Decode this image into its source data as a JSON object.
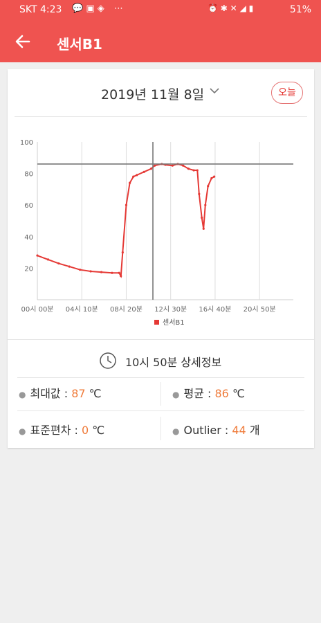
{
  "status_bar": {
    "carrier_time": "SKT 4:23",
    "notification_icons": [
      "chat-bubble-icon",
      "image-icon",
      "message-icon",
      "more-icon"
    ],
    "system_icons": [
      "alarm-icon",
      "bluetooth-icon",
      "mute-icon",
      "wifi-icon",
      "signal-icon"
    ],
    "battery": "51%"
  },
  "toolbar": {
    "back_icon": "arrow-left-icon",
    "title": "센서B1",
    "color": "#ef5350"
  },
  "date_selector": {
    "date": "2019년 11월 8일",
    "dropdown_icon": "chevron-down-icon",
    "today_label": "오늘"
  },
  "chart_data": {
    "type": "line",
    "x_tick_labels": [
      "00시 00분",
      "04시 10분",
      "08시 20분",
      "12시 30분",
      "16시 40분",
      "20시 50분"
    ],
    "y_ticks": [
      20,
      40,
      60,
      80,
      100
    ],
    "ylim": [
      0,
      100
    ],
    "xlim_minutes": [
      0,
      1440
    ],
    "grid": "vertical gridlines",
    "legend": "bottom-center",
    "series": [
      {
        "name": "센서B1",
        "color": "#e53935",
        "points": [
          [
            0,
            28
          ],
          [
            60,
            25.5
          ],
          [
            120,
            23
          ],
          [
            180,
            21
          ],
          [
            240,
            19
          ],
          [
            300,
            18
          ],
          [
            360,
            17.5
          ],
          [
            420,
            17
          ],
          [
            460,
            17
          ],
          [
            470,
            15
          ],
          [
            480,
            30
          ],
          [
            500,
            60
          ],
          [
            520,
            74
          ],
          [
            540,
            78
          ],
          [
            560,
            79
          ],
          [
            600,
            81
          ],
          [
            640,
            83
          ],
          [
            660,
            85
          ],
          [
            700,
            86
          ],
          [
            720,
            85.5
          ],
          [
            760,
            85
          ],
          [
            790,
            86
          ],
          [
            820,
            85
          ],
          [
            850,
            83
          ],
          [
            880,
            82
          ],
          [
            900,
            82
          ],
          [
            910,
            67
          ],
          [
            925,
            52
          ],
          [
            935,
            45
          ],
          [
            945,
            60
          ],
          [
            960,
            72
          ],
          [
            980,
            77
          ],
          [
            995,
            78
          ]
        ]
      }
    ],
    "crosshair": {
      "x_minutes": 650,
      "y": 86
    }
  },
  "detail_info": {
    "clock_icon": "clock-icon",
    "title": "10시 50분 상세정보",
    "max_label": "최대값",
    "max_value": "87",
    "avg_label": "평균",
    "avg_value": "86",
    "std_label": "표준편차",
    "std_value": "0",
    "outlier_label": "Outlier",
    "outlier_value": "44",
    "unit_celsius": "℃",
    "unit_count": "개",
    "separator": " : ",
    "value_color": "#ef7b3a"
  }
}
